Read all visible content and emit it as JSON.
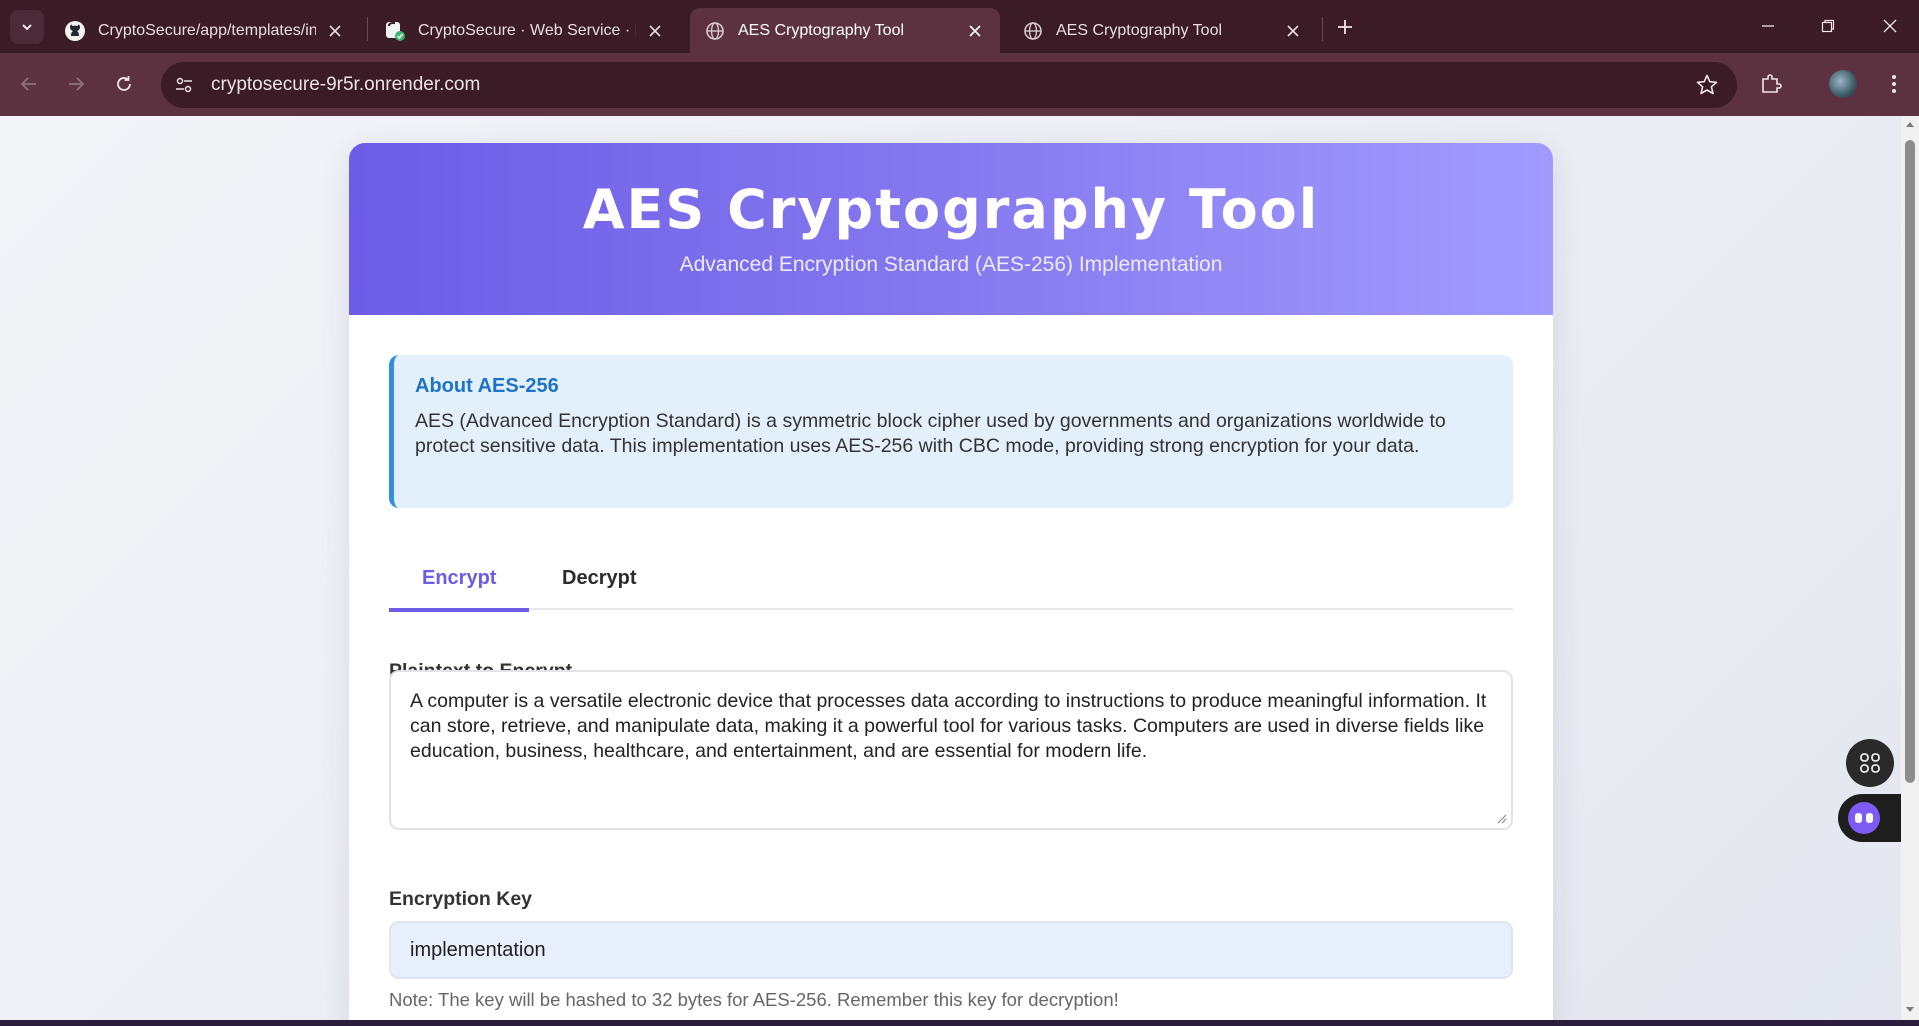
{
  "browser": {
    "tabs": [
      {
        "title": "CryptoSecure/app/templates/inde",
        "favicon": "github-icon",
        "active": false
      },
      {
        "title": "CryptoSecure · Web Service · Ren",
        "favicon": "render-icon",
        "active": false
      },
      {
        "title": "AES Cryptography Tool",
        "favicon": "globe-icon",
        "active": true
      },
      {
        "title": "AES Cryptography Tool",
        "favicon": "globe-icon",
        "active": false
      }
    ],
    "url": "cryptosecure-9r5r.onrender.com"
  },
  "page": {
    "title": "AES Cryptography Tool",
    "subtitle": "Advanced Encryption Standard (AES-256) Implementation",
    "about": {
      "heading": "About AES-256",
      "text": "AES (Advanced Encryption Standard) is a symmetric block cipher used by governments and organizations worldwide to protect sensitive data. This implementation uses AES-256 with CBC mode, providing strong encryption for your data."
    },
    "tabs": [
      {
        "label": "Encrypt",
        "active": true
      },
      {
        "label": "Decrypt",
        "active": false
      }
    ],
    "plaintext": {
      "label": "Plaintext to Encrypt",
      "value": "A computer is a versatile electronic device that processes data according to instructions to produce meaningful information. It can store, retrieve, and manipulate data, making it a powerful tool for various tasks. Computers are used in diverse fields like education, business, healthcare, and entertainment, and are essential for modern life."
    },
    "key": {
      "label": "Encryption Key",
      "value": "implementation",
      "note": "Note: The key will be hashed to 32 bytes for AES-256. Remember this key for decryption!"
    }
  },
  "colors": {
    "accent": "#6c5ce7",
    "info_border": "#2f91dd",
    "info_bg": "#e3f0fb",
    "browser_frame": "#3a1b26"
  }
}
